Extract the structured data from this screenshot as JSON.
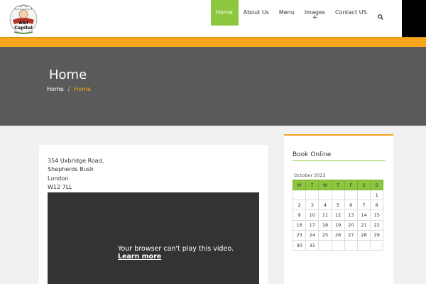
{
  "logo": {
    "line1": "A&I",
    "line2": "Capital"
  },
  "nav": {
    "items": [
      {
        "label": "Home",
        "active": true
      },
      {
        "label": "About Us"
      },
      {
        "label": "Menu"
      },
      {
        "label": "Images",
        "submenu_marker": "+"
      },
      {
        "label": "Contact US"
      }
    ],
    "search_icon": "search-icon"
  },
  "hero": {
    "title": "Home",
    "breadcrumb": {
      "home": "Home",
      "separator": "/",
      "current": "Home"
    }
  },
  "address": {
    "lines": [
      "354 Uxbridge Road,",
      "Shepherds Bush",
      "London",
      "W12 7LL"
    ]
  },
  "video": {
    "message": "Your browser can't play this video.",
    "link": "Learn more"
  },
  "booking": {
    "title": "Book Online",
    "month": "October 2023",
    "weekdays": [
      "M",
      "T",
      "W",
      "T",
      "F",
      "S",
      "S"
    ],
    "weeks": [
      [
        "",
        "",
        "",
        "",
        "",
        "",
        "1"
      ],
      [
        "2",
        "3",
        "4",
        "5",
        "6",
        "7",
        "8"
      ],
      [
        "9",
        "10",
        "11",
        "12",
        "13",
        "14",
        "15"
      ],
      [
        "16",
        "17",
        "18",
        "19",
        "20",
        "21",
        "22"
      ],
      [
        "23",
        "24",
        "25",
        "26",
        "27",
        "28",
        "29"
      ],
      [
        "30",
        "31",
        "",
        "",
        "",
        "",
        ""
      ]
    ]
  },
  "colors": {
    "accent_green": "#8dc63f",
    "accent_orange": "#f7a51c",
    "hero_bg": "#5a5a5a"
  }
}
